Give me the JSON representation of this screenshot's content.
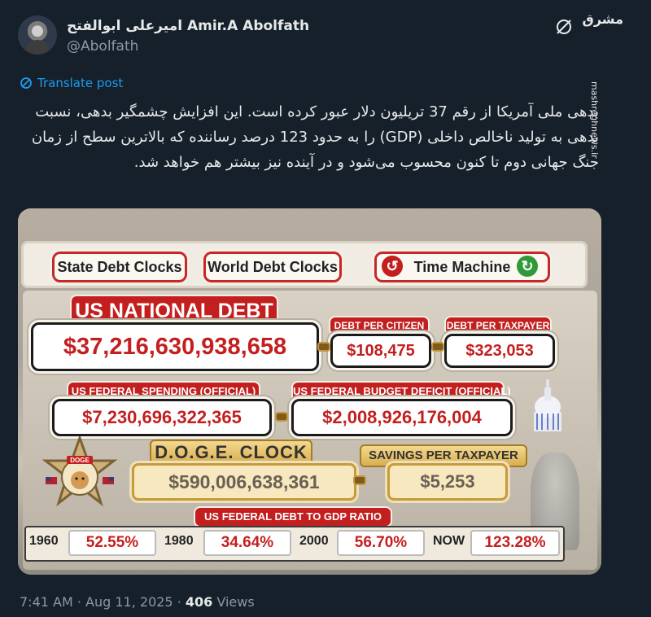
{
  "tweet": {
    "author_name": "امیرعلی ابوالفتح Amir.A Abolfath",
    "author_handle": "@Abolfath",
    "translate_label": "Translate post",
    "text": "بدهی ملی آمریکا از رقم 37 تریلیون دلار عبور کرده است. این افزایش چشمگیر بدهی، نسبت بدهی به تولید ناخالص داخلی (GDP) را به حدود 123 درصد رساننده که بالاترین سطح از زمان جنگ جهانی دوم تا کنون محسوب می‌شود و در آینده نیز بیشتر هم خواهد شد.",
    "time": "7:41 AM · Aug 11, 2025 ·",
    "views_count": "406",
    "views_label": "Views"
  },
  "watermark": {
    "logo": "مشرق",
    "site": "mashreghnews.ir"
  },
  "image": {
    "tabs": {
      "state": "State Debt Clocks",
      "world": "World Debt Clocks",
      "time_machine": "Time Machine"
    },
    "national_debt": {
      "label": "US NATIONAL DEBT",
      "value": "$37,216,630,938,658"
    },
    "per_citizen": {
      "label": "DEBT PER CITIZEN",
      "value": "$108,475"
    },
    "per_taxpayer": {
      "label": "DEBT PER TAXPAYER",
      "value": "$323,053"
    },
    "spending": {
      "label": "US FEDERAL SPENDING (OFFICIAL)",
      "value": "$7,230,696,322,365"
    },
    "deficit": {
      "label": "US FEDERAL BUDGET DEFICIT (OFFICIAL)",
      "value": "$2,008,926,176,004"
    },
    "doge": {
      "badge_text": "DOGE",
      "label": "D.O.G.E. CLOCK",
      "value": "$590,006,638,361"
    },
    "savings": {
      "label": "SAVINGS PER TAXPAYER",
      "value": "$5,253"
    },
    "ratio": {
      "label": "US FEDERAL DEBT TO GDP RATIO",
      "items": [
        {
          "year": "1960",
          "value": "52.55%"
        },
        {
          "year": "1980",
          "value": "34.64%"
        },
        {
          "year": "2000",
          "value": "56.70%"
        },
        {
          "year": "NOW",
          "value": "123.28%"
        }
      ]
    }
  },
  "colors": {
    "background": "#15202b",
    "link": "#1d9bf0",
    "debt_red": "#c41f1f",
    "muted": "#8b98a5"
  }
}
